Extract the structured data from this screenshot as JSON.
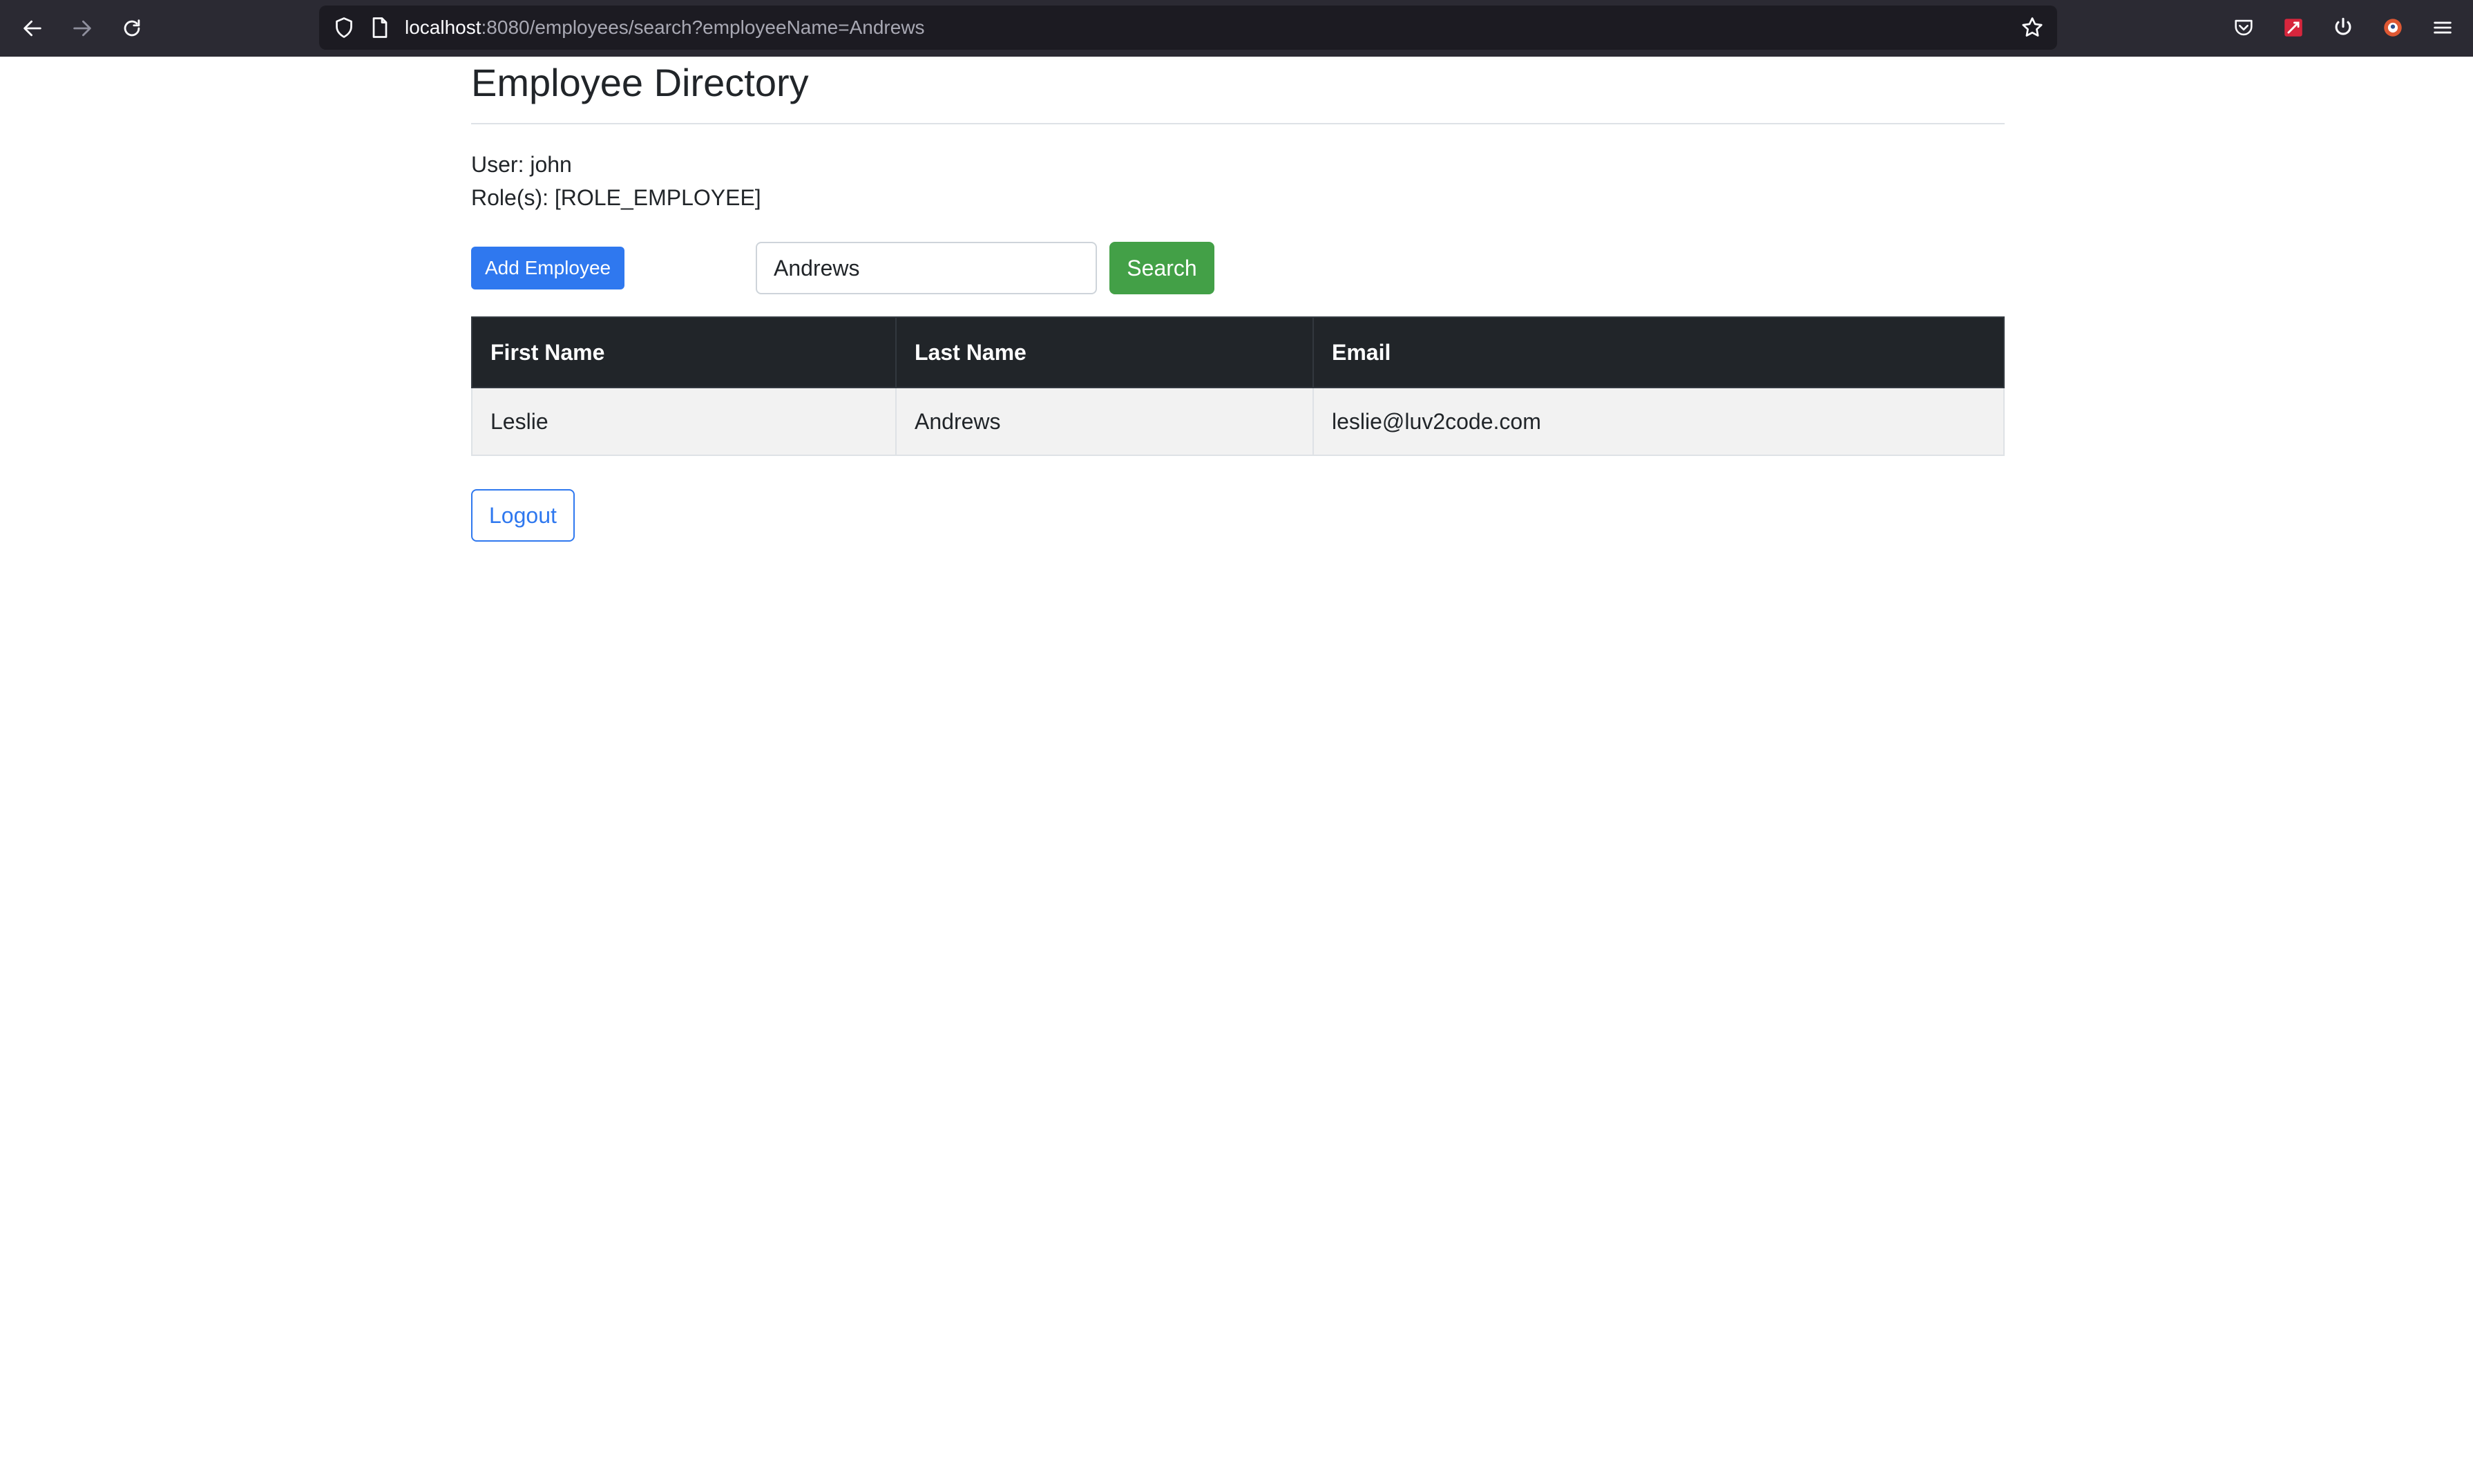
{
  "browser": {
    "url_host": "localhost",
    "url_rest": ":8080/employees/search?employeeName=Andrews"
  },
  "page": {
    "title": "Employee Directory",
    "user_label": "User: john",
    "roles_label": "Role(s): [ROLE_EMPLOYEE]"
  },
  "actions": {
    "add_label": "Add Employee",
    "search_value": "Andrews",
    "search_label": "Search"
  },
  "table": {
    "headers": [
      "First Name",
      "Last Name",
      "Email"
    ],
    "rows": [
      [
        "Leslie",
        "Andrews",
        "leslie@luv2code.com"
      ]
    ]
  },
  "logout_label": "Logout",
  "colors": {
    "primary": "#2f78ef",
    "success": "#43a047",
    "table_header": "#212529"
  }
}
